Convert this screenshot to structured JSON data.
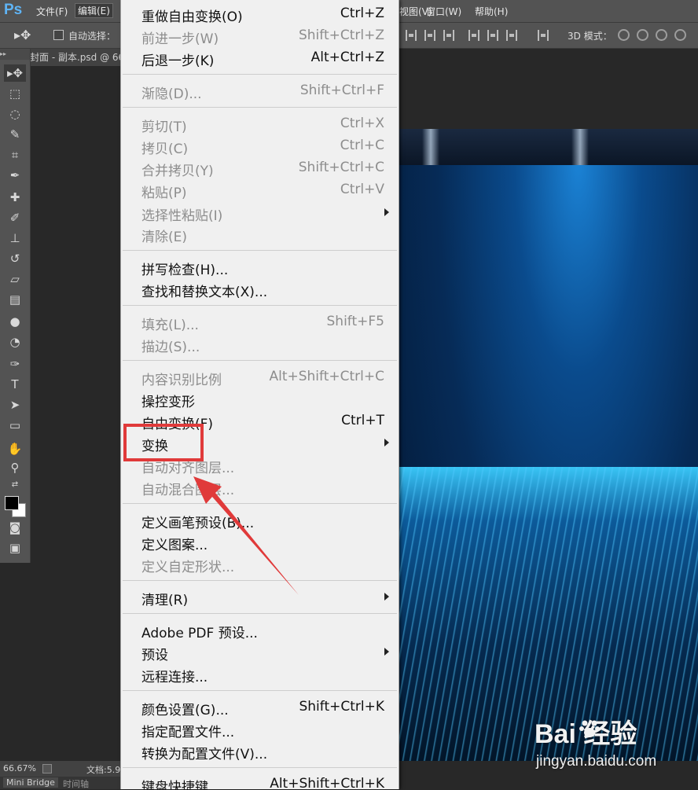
{
  "app": {
    "logo": "Ps",
    "menus": [
      {
        "label": "文件(F)"
      },
      {
        "label": "编辑(E)"
      },
      {
        "label": "视图(V)"
      },
      {
        "label": "窗口(W)"
      },
      {
        "label": "帮助(H)"
      }
    ]
  },
  "options": {
    "auto_select_label": "自动选择：",
    "mode_3d_label": "3D 模式："
  },
  "document": {
    "tab_title": "封面 - 副本.psd @ 66"
  },
  "status": {
    "zoom": "66.67%",
    "doc_info": "文档:5.9"
  },
  "bottom_tabs": [
    "Mini Bridge",
    "时间轴"
  ],
  "edit_menu": {
    "items": [
      {
        "label": "重做自由变换(O)",
        "shortcut": "Ctrl+Z",
        "disabled": false
      },
      {
        "label": "前进一步(W)",
        "shortcut": "Shift+Ctrl+Z",
        "disabled": true
      },
      {
        "label": "后退一步(K)",
        "shortcut": "Alt+Ctrl+Z",
        "disabled": false
      },
      {
        "label": "渐隐(D)...",
        "shortcut": "Shift+Ctrl+F",
        "disabled": true
      },
      {
        "label": "剪切(T)",
        "shortcut": "Ctrl+X",
        "disabled": true
      },
      {
        "label": "拷贝(C)",
        "shortcut": "Ctrl+C",
        "disabled": true
      },
      {
        "label": "合并拷贝(Y)",
        "shortcut": "Shift+Ctrl+C",
        "disabled": true
      },
      {
        "label": "粘贴(P)",
        "shortcut": "Ctrl+V",
        "disabled": true
      },
      {
        "label": "选择性粘贴(I)",
        "shortcut": "",
        "disabled": true,
        "submenu": true
      },
      {
        "label": "清除(E)",
        "shortcut": "",
        "disabled": true
      },
      {
        "label": "拼写检查(H)...",
        "shortcut": "",
        "disabled": false
      },
      {
        "label": "查找和替换文本(X)...",
        "shortcut": "",
        "disabled": false
      },
      {
        "label": "填充(L)...",
        "shortcut": "Shift+F5",
        "disabled": true
      },
      {
        "label": "描边(S)...",
        "shortcut": "",
        "disabled": true
      },
      {
        "label": "内容识别比例",
        "shortcut": "Alt+Shift+Ctrl+C",
        "disabled": true
      },
      {
        "label": "操控变形",
        "shortcut": "",
        "disabled": false
      },
      {
        "label": "自由变换(F)",
        "shortcut": "Ctrl+T",
        "disabled": false
      },
      {
        "label": "变换",
        "shortcut": "",
        "disabled": false,
        "submenu": true
      },
      {
        "label": "自动对齐图层...",
        "shortcut": "",
        "disabled": true
      },
      {
        "label": "自动混合图层...",
        "shortcut": "",
        "disabled": true
      },
      {
        "label": "定义画笔预设(B)...",
        "shortcut": "",
        "disabled": false
      },
      {
        "label": "定义图案...",
        "shortcut": "",
        "disabled": false
      },
      {
        "label": "定义自定形状...",
        "shortcut": "",
        "disabled": true
      },
      {
        "label": "清理(R)",
        "shortcut": "",
        "disabled": false,
        "submenu": true
      },
      {
        "label": "Adobe PDF 预设...",
        "shortcut": "",
        "disabled": false
      },
      {
        "label": "预设",
        "shortcut": "",
        "disabled": false,
        "submenu": true
      },
      {
        "label": "远程连接...",
        "shortcut": "",
        "disabled": false
      },
      {
        "label": "颜色设置(G)...",
        "shortcut": "Shift+Ctrl+K",
        "disabled": false
      },
      {
        "label": "指定配置文件...",
        "shortcut": "",
        "disabled": false
      },
      {
        "label": "转换为配置文件(V)...",
        "shortcut": "",
        "disabled": false
      },
      {
        "label": "键盘快捷键...",
        "shortcut": "Alt+Shift+Ctrl+K",
        "disabled": false
      }
    ]
  },
  "watermark": {
    "logo_text": "Bai  经验",
    "url": "jingyan.baidu.com"
  },
  "colors": {
    "highlight": "#e03a3a",
    "menu_bg": "#f0f0f0",
    "disabled_text": "#8d8d8d"
  }
}
